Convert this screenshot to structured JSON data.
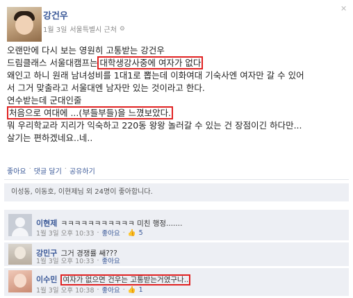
{
  "post": {
    "author": "강건우",
    "timestamp": "1월 3일",
    "location": "서울특별시 근처",
    "lines": [
      "오랜만에 다시 보는 영원히 고통받는 강건우",
      "드림클래스 서울대캠프는",
      "대학생강사중에 여자가 없다",
      "왜인고 하니 원래 남녀성비를 1대1로 뽑는데 이화여대 기숙사엔 여자만 갈 수 있어",
      "서 그거 맞출라고 서울대엔 남자만 있는 것이라고 한다.",
      "연수받는데 군대인줄",
      "처음으로 여대에 ...(부들부들)을 느꼈보았다.",
      "뭐 우리학교라 지리가 익숙하고 220동 왕왕 놀러갈 수 있는 건 장점이긴 하다만...",
      "살기는 편하겠네요..네.."
    ]
  },
  "actions": {
    "like": "좋아요",
    "comment": "댓글 달기",
    "share": "공유하기",
    "sep": "·"
  },
  "likes_text": "이성동, 이동호, 이현제님 외 24명이 좋아합니다.",
  "comments": [
    {
      "name": "이현제",
      "text": "ㅋㅋㅋㅋㅋㅋㅋㅋㅋㅋㅋ 미친 행정.......",
      "time": "1월 3일 오후 10:33",
      "like": "좋아요",
      "count": "5"
    },
    {
      "name": "강민구",
      "text": "그거 경쟁률 쌔???",
      "time": "1월 3일 오후 10:33",
      "like": "좋아요",
      "count": ""
    },
    {
      "name": "이수민",
      "text": "여자가 없으면 건우는 고통받는거였구나..",
      "time": "1월 3일 오후 10:38",
      "like": "좋아요",
      "count": "1"
    }
  ]
}
